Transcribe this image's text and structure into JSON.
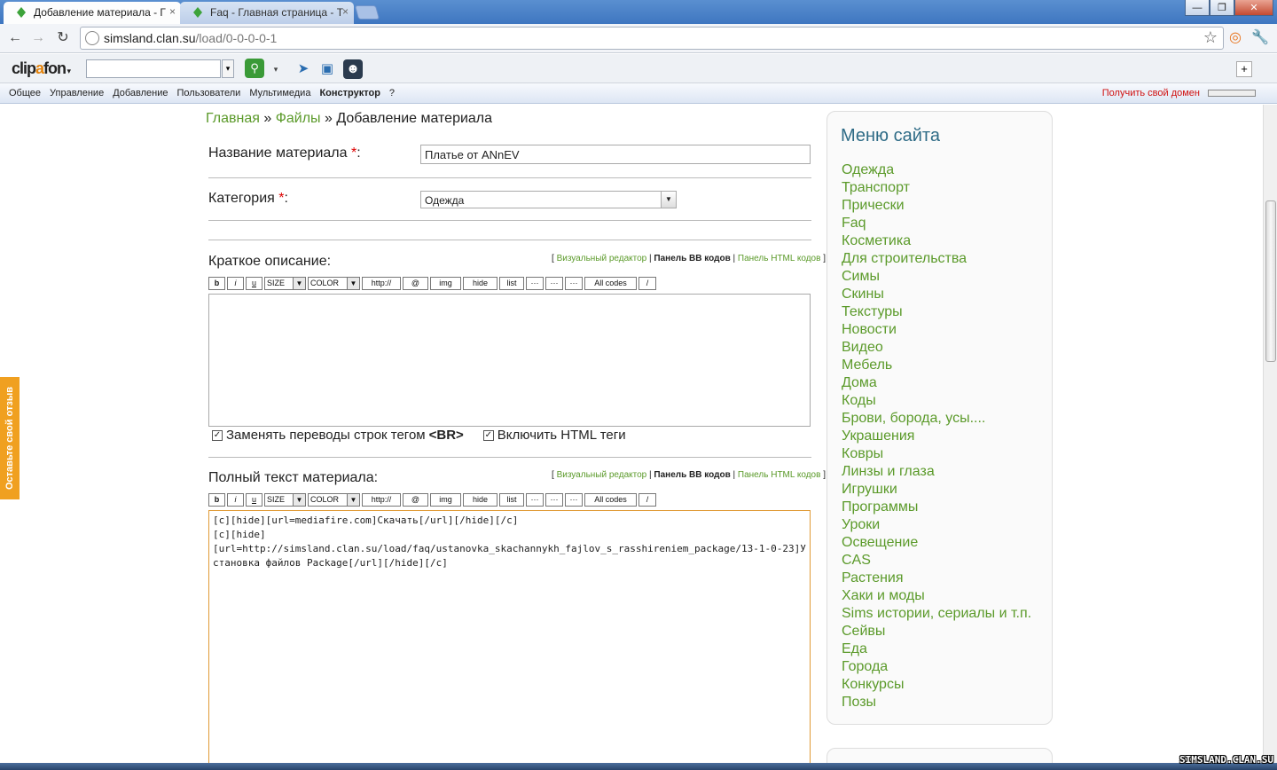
{
  "browser": {
    "tabs": [
      {
        "title": "Добавление материала - Г",
        "active": true
      },
      {
        "title": "Faq - Главная страница - Т",
        "active": false
      }
    ],
    "url_host": "simsland.clan.su",
    "url_path": "/load/0-0-0-0-1"
  },
  "clipafon": {
    "logo_pre": "clip",
    "logo_accent": "a",
    "logo_post": "fon",
    "search_value": ""
  },
  "ucoz_bar": {
    "menu": [
      "Общее",
      "Управление",
      "Добавление",
      "Пользователи",
      "Мультимедиа",
      "Конструктор",
      "?"
    ],
    "get_domain": "Получить свой домен"
  },
  "feedback_tab": "Оставьте свой отзыв",
  "breadcrumb": {
    "home": "Главная",
    "sep": "»",
    "files": "Файлы",
    "current": "Добавление материала"
  },
  "form": {
    "title_label": "Название материала",
    "title_value": "Платье от ANnEV",
    "category_label": "Категория",
    "category_value": "Одежда",
    "req_mark": "*",
    "colon": ":",
    "short_label": "Краткое описание:",
    "full_label": "Полный текст материала:",
    "editor_links": {
      "open": "[",
      "visual": "Визуальный редактор",
      "bb": "Панель BB кодов",
      "html": "Панель HTML кодов",
      "sep": "|",
      "close": "]"
    },
    "bb_buttons": [
      "b",
      "i",
      "u",
      "SIZE",
      "COLOR",
      "http://",
      "@",
      "img",
      "hide",
      "list",
      "···",
      "···",
      "···",
      "All codes",
      "/"
    ],
    "short_text": "",
    "chk_br_label": "Заменять переводы строк тегом",
    "chk_br_tag": "<BR>",
    "chk_html_label": "Включить HTML теги",
    "full_text": "[c][hide][url=mediafire.com]Скачать[/url][/hide][/c]\n[c][hide]\n[url=http://simsland.clan.su/load/faq/ustanovka_skachannykh_fajlov_s_rasshireniem_package/13-1-0-23]Установка файлов Package[/url][/hide][/c]"
  },
  "sidebar": {
    "title": "Меню сайта",
    "items": [
      "Одежда",
      "Транспорт",
      "Прически",
      "Faq",
      "Косметика",
      "Для строительства",
      "Симы",
      "Скины",
      "Текстуры",
      "Новости",
      "Видео",
      "Мебель",
      "Дома",
      "Коды",
      "Брови, борода, усы....",
      "Украшения",
      "Ковры",
      "Линзы и глаза",
      "Игрушки",
      "Программы",
      "Уроки",
      "Освещение",
      "CAS",
      "Растения",
      "Хаки и моды",
      "Sims истории, сериалы и т.п.",
      "Сейвы",
      "Еда",
      "Города",
      "Конкурсы",
      "Позы"
    ]
  },
  "watermark": "SIMSLAND.CLAN.SU",
  "colors": {
    "link": "#5b9a2a",
    "title": "#2e6b86",
    "accent": "#f0a020"
  }
}
